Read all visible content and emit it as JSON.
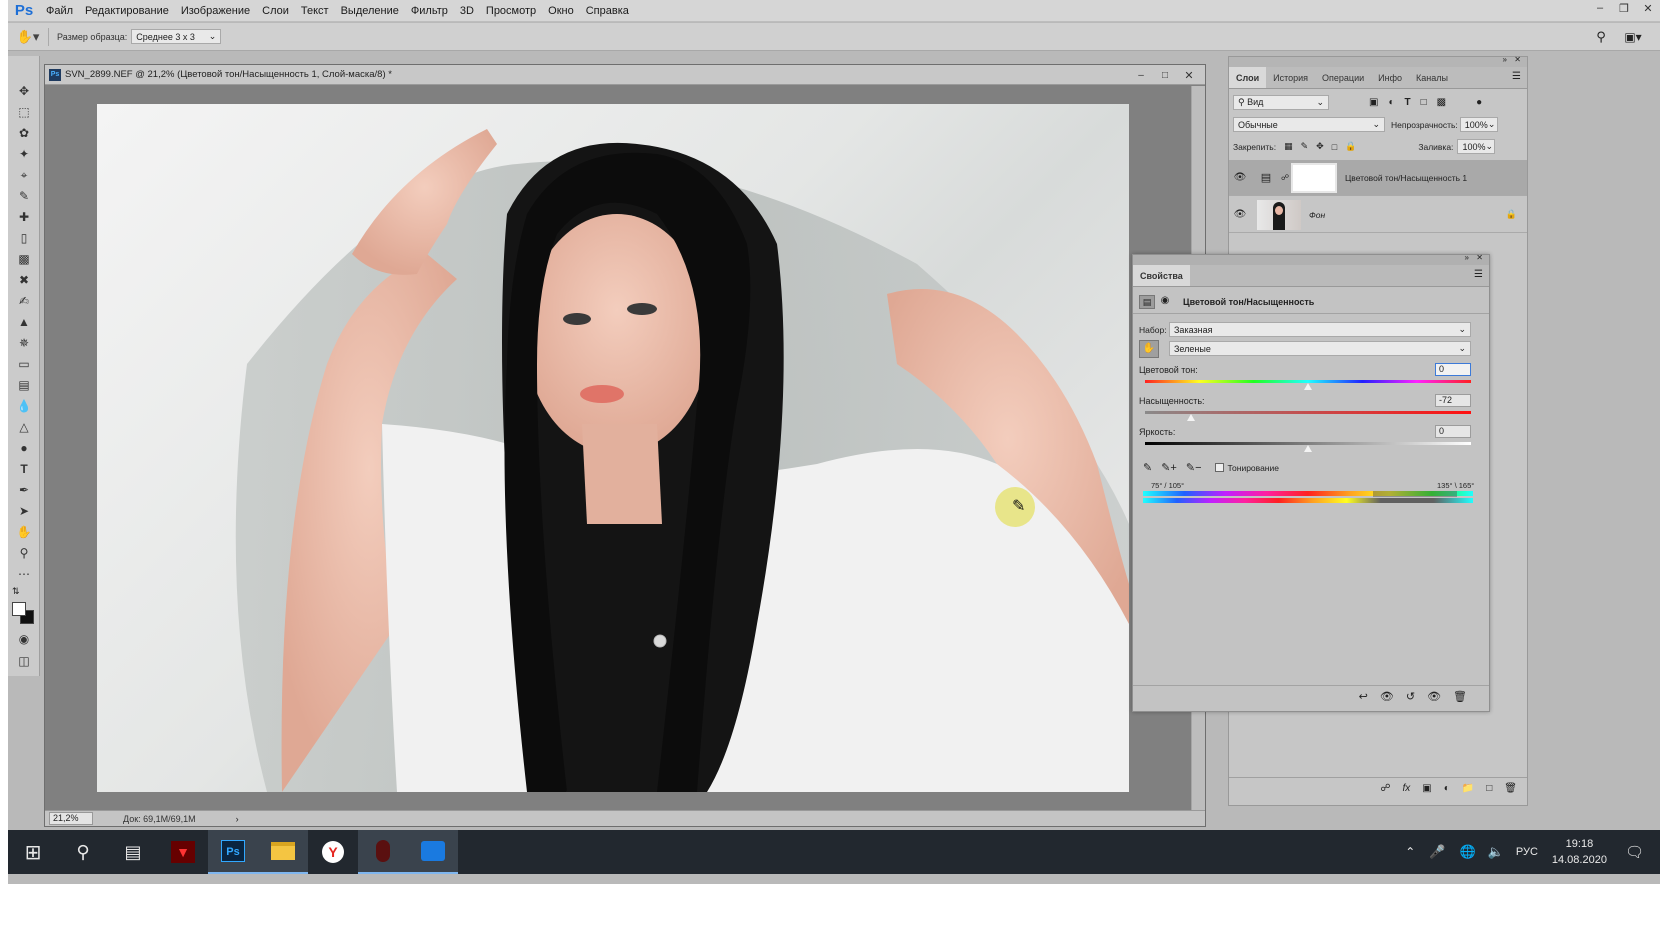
{
  "app": {
    "logo": "Ps"
  },
  "menu": [
    "Файл",
    "Редактирование",
    "Изображение",
    "Слои",
    "Текст",
    "Выделение",
    "Фильтр",
    "3D",
    "Просмотр",
    "Окно",
    "Справка"
  ],
  "options": {
    "sample_size_label": "Размер образца:",
    "sample_size_value": "Среднее 3 х 3"
  },
  "document": {
    "title": "SVN_2899.NEF @ 21,2% (Цветовой тон/Насыщенность 1, Слой-маска/8) *",
    "zoom": "21,2%",
    "doc_size": "Док: 69,1M/69,1M"
  },
  "layers_panel": {
    "tabs": [
      "Слои",
      "История",
      "Операции",
      "Инфо",
      "Каналы"
    ],
    "filter_label": "Вид",
    "blend_mode": "Обычные",
    "opacity_label": "Непрозрачность:",
    "opacity_value": "100%",
    "lock_label": "Закрепить:",
    "fill_label": "Заливка:",
    "fill_value": "100%",
    "layers": [
      {
        "name": "Цветовой тон/Насыщенность 1"
      },
      {
        "name": "Фон"
      }
    ]
  },
  "properties": {
    "tab": "Свойства",
    "adjustment_title": "Цветовой тон/Насыщенность",
    "preset_label": "Набор:",
    "preset_value": "Заказная",
    "channel_value": "Зеленые",
    "hue_label": "Цветовой тон:",
    "hue_value": "0",
    "hue_level": 0.5,
    "saturation_label": "Насыщенность:",
    "saturation_value": "-72",
    "saturation_level": 0.14,
    "lightness_label": "Яркость:",
    "lightness_value": "0",
    "lightness_level": 0.5,
    "colorize_label": "Тонирование",
    "range_left": "75° / 105°",
    "range_right": "135° \\ 165°"
  },
  "taskbar": {
    "language": "РУС",
    "time": "19:18",
    "date": "14.08.2020"
  },
  "colors": {
    "accent": "#1e6fd6",
    "workspace": "#b9b9b9",
    "taskbar": "#22282f",
    "highlight": "#e6e3a0"
  }
}
